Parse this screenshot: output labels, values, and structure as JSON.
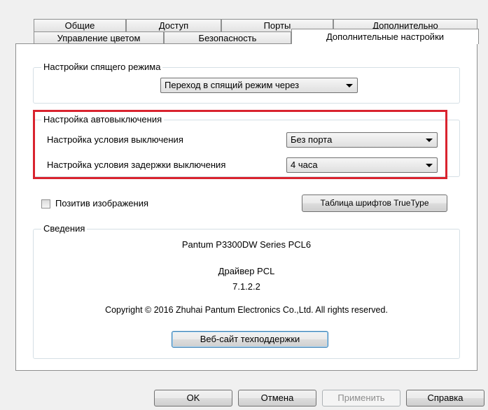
{
  "tabs_row1": [
    "Общие",
    "Доступ",
    "Порты",
    "Дополнительно"
  ],
  "tabs_row2": [
    "Управление цветом",
    "Безопасность",
    "Дополнительные настройки"
  ],
  "sleep": {
    "group_label": "Настройки спящего режима",
    "dropdown_value": "Переход в спящий режим через"
  },
  "autooff": {
    "group_label": "Настройка автовыключения",
    "condition_label": "Настройка условия выключения",
    "condition_value": "Без порта",
    "delay_label": "Настройка условия задержки выключения",
    "delay_value": "4 часа"
  },
  "image_positive": {
    "label": "Позитив изображения",
    "checked": false
  },
  "truetype_button": "Таблица шрифтов TrueType",
  "info": {
    "group_label": "Сведения",
    "model": "Pantum P3300DW Series PCL6",
    "driver": "Драйвер PCL",
    "version": "7.1.2.2",
    "copyright": "Copyright © 2016 Zhuhai Pantum Electronics Co.,Ltd. All rights reserved.",
    "support_button": "Веб-сайт техподдержки"
  },
  "footer": {
    "ok": "OK",
    "cancel": "Отмена",
    "apply": "Применить",
    "help": "Справка"
  },
  "colors": {
    "highlight": "#d9232e",
    "default_button_border": "#3c7fb1"
  }
}
